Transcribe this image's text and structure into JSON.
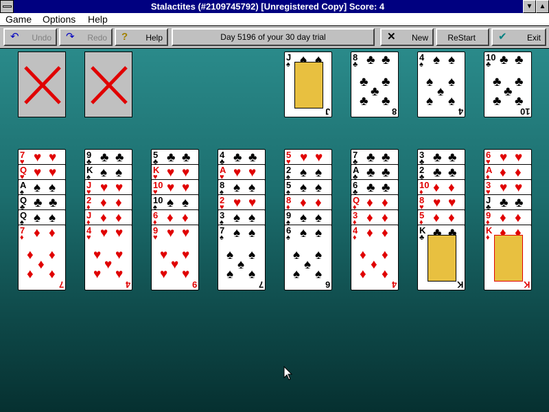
{
  "window": {
    "title": "Stalactites (#2109745792) [Unregistered Copy]  Score:  4",
    "minimize_glyph": "▼",
    "maximize_glyph": "▲"
  },
  "menu": [
    {
      "label": "Game",
      "accel": "G"
    },
    {
      "label": "Options",
      "accel": "O"
    },
    {
      "label": "Help",
      "accel": "H"
    }
  ],
  "toolbar": {
    "undo": {
      "label": "Undo",
      "icon": "↶",
      "icon_name": "undo-arrow-icon"
    },
    "redo": {
      "label": "Redo",
      "icon": "↷",
      "icon_name": "redo-arrow-icon"
    },
    "help": {
      "label": "Help",
      "icon": "?",
      "icon_name": "question-icon"
    },
    "status": "Day 5196 of your 30 day trial",
    "new": {
      "label": "New",
      "icon": "✕",
      "icon_name": "x-icon"
    },
    "restart": {
      "label": "ReStart"
    },
    "exit": {
      "label": "Exit",
      "icon": "✔",
      "icon_name": "checkmark-icon"
    }
  },
  "colors": {
    "red": "#e00000",
    "felt_top": "#2a8a8a",
    "felt_bottom": "#063030"
  },
  "reserves": [
    {
      "state": "empty-x"
    },
    {
      "state": "empty-x"
    }
  ],
  "foundations": [
    {
      "rank": "J",
      "suit": "♠"
    },
    {
      "rank": "8",
      "suit": "♣"
    },
    {
      "rank": "4",
      "suit": "♠"
    },
    {
      "rank": "10",
      "suit": "♣"
    }
  ],
  "tableau": [
    [
      {
        "rank": "7",
        "suit": "♥"
      },
      {
        "rank": "Q",
        "suit": "♥"
      },
      {
        "rank": "A",
        "suit": "♠"
      },
      {
        "rank": "Q",
        "suit": "♣"
      },
      {
        "rank": "Q",
        "suit": "♠"
      },
      {
        "rank": "7",
        "suit": "♦"
      }
    ],
    [
      {
        "rank": "9",
        "suit": "♣"
      },
      {
        "rank": "K",
        "suit": "♠"
      },
      {
        "rank": "J",
        "suit": "♥"
      },
      {
        "rank": "2",
        "suit": "♦"
      },
      {
        "rank": "J",
        "suit": "♦"
      },
      {
        "rank": "4",
        "suit": "♥"
      }
    ],
    [
      {
        "rank": "5",
        "suit": "♣"
      },
      {
        "rank": "K",
        "suit": "♥"
      },
      {
        "rank": "10",
        "suit": "♥"
      },
      {
        "rank": "10",
        "suit": "♠"
      },
      {
        "rank": "6",
        "suit": "♦"
      },
      {
        "rank": "9",
        "suit": "♥"
      }
    ],
    [
      {
        "rank": "4",
        "suit": "♣"
      },
      {
        "rank": "A",
        "suit": "♥"
      },
      {
        "rank": "8",
        "suit": "♠"
      },
      {
        "rank": "2",
        "suit": "♥"
      },
      {
        "rank": "3",
        "suit": "♠"
      },
      {
        "rank": "7",
        "suit": "♠"
      }
    ],
    [
      {
        "rank": "5",
        "suit": "♥"
      },
      {
        "rank": "2",
        "suit": "♠"
      },
      {
        "rank": "5",
        "suit": "♠"
      },
      {
        "rank": "8",
        "suit": "♦"
      },
      {
        "rank": "9",
        "suit": "♠"
      },
      {
        "rank": "6",
        "suit": "♠"
      }
    ],
    [
      {
        "rank": "7",
        "suit": "♣"
      },
      {
        "rank": "A",
        "suit": "♣"
      },
      {
        "rank": "6",
        "suit": "♣"
      },
      {
        "rank": "Q",
        "suit": "♦"
      },
      {
        "rank": "3",
        "suit": "♦"
      },
      {
        "rank": "4",
        "suit": "♦"
      }
    ],
    [
      {
        "rank": "3",
        "suit": "♣"
      },
      {
        "rank": "2",
        "suit": "♣"
      },
      {
        "rank": "10",
        "suit": "♦"
      },
      {
        "rank": "8",
        "suit": "♥"
      },
      {
        "rank": "5",
        "suit": "♦"
      },
      {
        "rank": "K",
        "suit": "♣"
      }
    ],
    [
      {
        "rank": "6",
        "suit": "♥"
      },
      {
        "rank": "A",
        "suit": "♦"
      },
      {
        "rank": "3",
        "suit": "♥"
      },
      {
        "rank": "J",
        "suit": "♣"
      },
      {
        "rank": "9",
        "suit": "♦"
      },
      {
        "rank": "K",
        "suit": "♦"
      }
    ]
  ]
}
